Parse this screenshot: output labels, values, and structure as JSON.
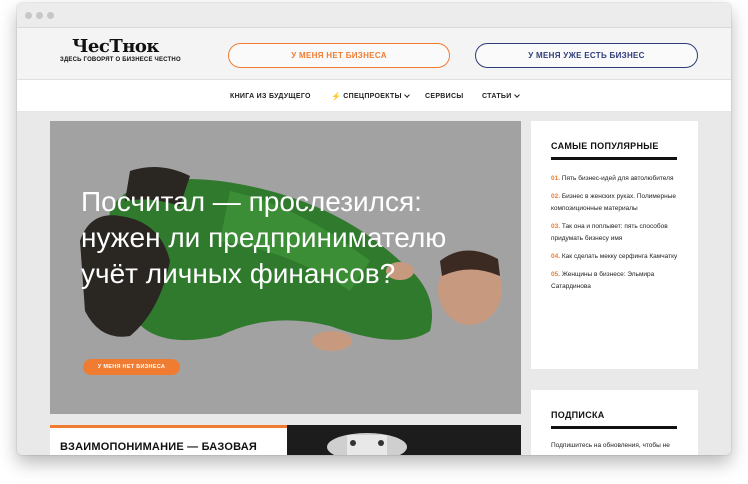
{
  "header": {
    "logo": "ЧесТнок",
    "tagline": "ЗДЕСЬ ГОВОРЯТ О БИЗНЕСЕ ЧЕСТНО",
    "btn_no_business": "У МЕНЯ НЕТ БИЗНЕСА",
    "btn_have_business": "У МЕНЯ УЖЕ ЕСТЬ БИЗНЕС"
  },
  "nav": {
    "items": [
      {
        "label": "КНИГА ИЗ БУДУЩЕГО"
      },
      {
        "label": "СПЕЦПРОЕКТЫ"
      },
      {
        "label": "СЕРВИСЫ"
      },
      {
        "label": "СТАТЬИ"
      }
    ]
  },
  "hero": {
    "title": "Посчитал — прослезился: нужен ли предпринимателю учёт личных финансов?",
    "tag": "У МЕНЯ НЕТ БИЗНЕСА"
  },
  "bottom_card": {
    "title": "ВЗАИМОПОНИМАНИЕ — БАЗОВАЯ"
  },
  "popular": {
    "title": "САМЫЕ ПОПУЛЯРНЫЕ",
    "items": [
      {
        "num": "01.",
        "text": "Пять бизнес-идей для автолюбителя"
      },
      {
        "num": "02.",
        "text": "Бизнес в женских руках. Полимерные композиционные материалы"
      },
      {
        "num": "03.",
        "text": "Так она и поплывет: пять способов придумать бизнесу имя"
      },
      {
        "num": "04.",
        "text": "Как сделать мекку серфинга Камчатку"
      },
      {
        "num": "05.",
        "text": "Женщины в бизнесе: Эльмира Сатардинова"
      }
    ]
  },
  "subscribe": {
    "title": "ПОДПИСКА",
    "text": "Подпишитесь на обновления, чтобы не пропустить самые новости"
  },
  "colors": {
    "accent": "#f07c32",
    "navy": "#2e3c7a"
  }
}
